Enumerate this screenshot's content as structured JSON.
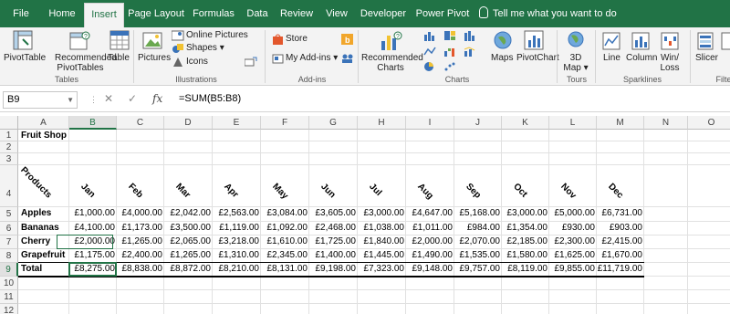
{
  "tabs": [
    "File",
    "Home",
    "Insert",
    "Page Layout",
    "Formulas",
    "Data",
    "Review",
    "View",
    "Developer",
    "Power Pivot"
  ],
  "active_tab": "Insert",
  "tell_me": "Tell me what you want to do",
  "ribbon": {
    "pivottable": "PivotTable",
    "recommended_pivot_1": "Recommended",
    "recommended_pivot_2": "PivotTables",
    "table": "Table",
    "pictures": "Pictures",
    "online_pictures": "Online Pictures",
    "shapes": "Shapes",
    "icons": "Icons",
    "store": "Store",
    "my_addins": "My Add-ins",
    "recommended_charts_1": "Recommended",
    "recommended_charts_2": "Charts",
    "maps": "Maps",
    "pivotchart": "PivotChart",
    "map3d_1": "3D",
    "map3d_2": "Map",
    "line": "Line",
    "column": "Column",
    "winloss_1": "Win/",
    "winloss_2": "Loss",
    "slicer": "Slicer",
    "filter": "Filte",
    "groups": {
      "tables": "Tables",
      "illustrations": "Illustrations",
      "addins": "Add-ins",
      "charts": "Charts",
      "tours": "Tours",
      "sparklines": "Sparklines",
      "filters": "Filte"
    }
  },
  "formula_bar": {
    "name_box": "B9",
    "cancel": "✕",
    "enter": "✓",
    "fx": "fx",
    "formula": "=SUM(B5:B8)"
  },
  "columns": [
    "A",
    "B",
    "C",
    "D",
    "E",
    "F",
    "G",
    "H",
    "I",
    "J",
    "K",
    "L",
    "M",
    "N",
    "O"
  ],
  "selected_column": "B",
  "row_numbers": [
    "1",
    "2",
    "3",
    "4",
    "5",
    "6",
    "7",
    "8",
    "9",
    "10",
    "11",
    "12"
  ],
  "selected_row": "9",
  "sheet": {
    "title": "Fruit Shop",
    "products_header": "Products",
    "months": [
      "Jan",
      "Feb",
      "Mar",
      "Apr",
      "May",
      "Jun",
      "Jul",
      "Aug",
      "Sep",
      "Oct",
      "Nov",
      "Dec"
    ],
    "rows": [
      {
        "label": "Apples",
        "values": [
          "£1,000.00",
          "£4,000.00",
          "£2,042.00",
          "£2,563.00",
          "£3,084.00",
          "£3,605.00",
          "£3,000.00",
          "£4,647.00",
          "£5,168.00",
          "£3,000.00",
          "£5,000.00",
          "£6,731.00"
        ]
      },
      {
        "label": "Bananas",
        "values": [
          "£4,100.00",
          "£1,173.00",
          "£3,500.00",
          "£1,119.00",
          "£1,092.00",
          "£2,468.00",
          "£1,038.00",
          "£1,011.00",
          "£984.00",
          "£1,354.00",
          "£930.00",
          "£903.00"
        ]
      },
      {
        "label": "Cherry",
        "values": [
          "£2,000.00",
          "£1,265.00",
          "£2,065.00",
          "£3,218.00",
          "£1,610.00",
          "£1,725.00",
          "£1,840.00",
          "£2,000.00",
          "£2,070.00",
          "£2,185.00",
          "£2,300.00",
          "£2,415.00"
        ]
      },
      {
        "label": "Grapefruit",
        "values": [
          "£1,175.00",
          "£2,400.00",
          "£1,265.00",
          "£1,310.00",
          "£2,345.00",
          "£1,400.00",
          "£1,445.00",
          "£1,490.00",
          "£1,535.00",
          "£1,580.00",
          "£1,625.00",
          "£1,670.00"
        ]
      },
      {
        "label": "Total",
        "values": [
          "£8,275.00",
          "£8,838.00",
          "£8,872.00",
          "£8,210.00",
          "£8,131.00",
          "£9,198.00",
          "£7,323.00",
          "£9,148.00",
          "£9,757.00",
          "£8,119.00",
          "£9,855.00",
          "£11,719.00"
        ]
      }
    ]
  },
  "colors": {
    "excel_green": "#217346",
    "ribbon_bg": "#f3f3f3",
    "gridline": "#e1e1e1"
  }
}
